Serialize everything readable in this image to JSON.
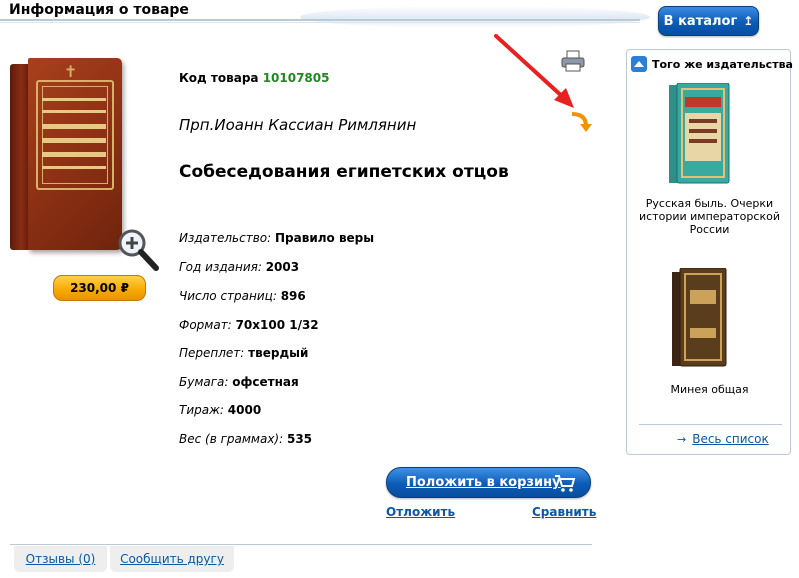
{
  "header": {
    "title": "Информация о товаре",
    "catalog_button": "В каталог"
  },
  "product": {
    "price": "230,00 ₽",
    "code_label": "Код товара",
    "code_value": "10107805",
    "author": "Прп.Иоанн Кассиан Римлянин",
    "title": "Собеседования египетских отцов",
    "specs": [
      {
        "label": "Издательство:",
        "value": "Правило веры"
      },
      {
        "label": "Год издания:",
        "value": "2003"
      },
      {
        "label": "Число страниц:",
        "value": "896"
      },
      {
        "label": "Формат:",
        "value": "70х100 1/32"
      },
      {
        "label": "Переплет:",
        "value": "твердый"
      },
      {
        "label": "Бумага:",
        "value": "офсетная"
      },
      {
        "label": "Тираж:",
        "value": "4000"
      },
      {
        "label": "Вес (в граммах):",
        "value": "535"
      }
    ]
  },
  "actions": {
    "cart_button": "Положить в корзину",
    "postpone": "Отложить",
    "compare": "Сравнить"
  },
  "tabs": [
    {
      "label": "Отзывы (0)"
    },
    {
      "label": "Сообщить другу"
    }
  ],
  "sidebar": {
    "title": "Того же издательства",
    "items": [
      {
        "caption": "Русская быль. Очерки истории императорской России"
      },
      {
        "caption": "Минея общая"
      }
    ],
    "all_link": "Весь список"
  },
  "colors": {
    "accent_blue": "#0d5cb8",
    "link_blue": "#0a58a6",
    "price_orange": "#f7a800",
    "code_green": "#1f8a1f",
    "annotation_red": "#e82020"
  },
  "icons": [
    "print-icon",
    "share-arrow-icon",
    "zoom-icon",
    "cart-icon",
    "sidebar-arrow-icon"
  ]
}
